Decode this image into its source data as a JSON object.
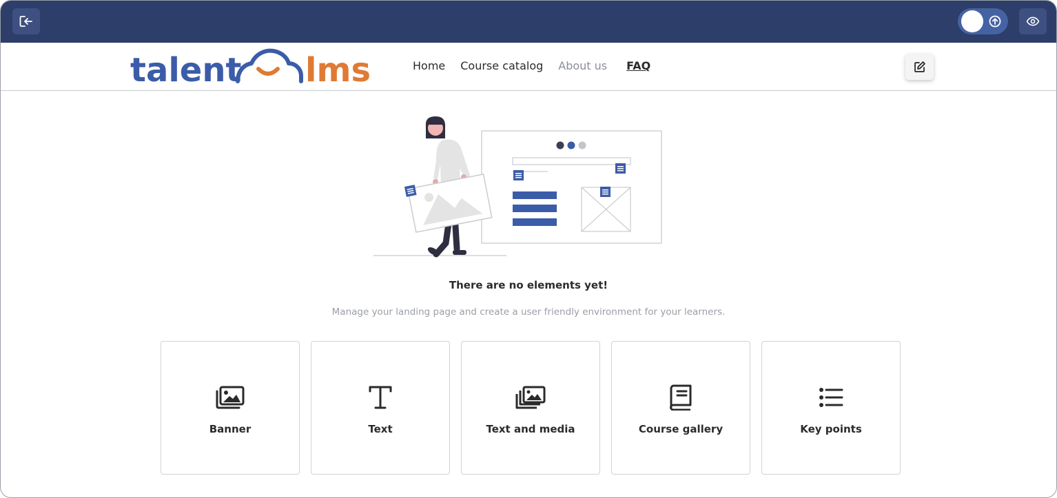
{
  "toolbar": {
    "exit_icon": "exit-icon",
    "toggle_icon": "upload-circle-icon",
    "preview_icon": "eye-icon"
  },
  "header": {
    "logo": {
      "part1": "talent",
      "part2": "lms",
      "color_primary": "#3b5ca8",
      "color_accent": "#e07a33"
    },
    "nav": [
      {
        "label": "Home"
      },
      {
        "label": "Course catalog"
      },
      {
        "label": "About us"
      },
      {
        "label": "FAQ"
      }
    ],
    "edit_icon": "edit-icon"
  },
  "empty_state": {
    "title": "There are no elements yet!",
    "subtitle": "Manage your landing page and create a user friendly environment for your learners."
  },
  "cards": [
    {
      "label": "Banner",
      "icon": "banner-image-icon"
    },
    {
      "label": "Text",
      "icon": "text-icon"
    },
    {
      "label": "Text and media",
      "icon": "media-gallery-icon"
    },
    {
      "label": "Course gallery",
      "icon": "book-icon"
    },
    {
      "label": "Key points",
      "icon": "list-icon"
    }
  ],
  "colors": {
    "topbar": "#2c3e69",
    "button": "#3e5081",
    "toggle": "#4563a3"
  }
}
